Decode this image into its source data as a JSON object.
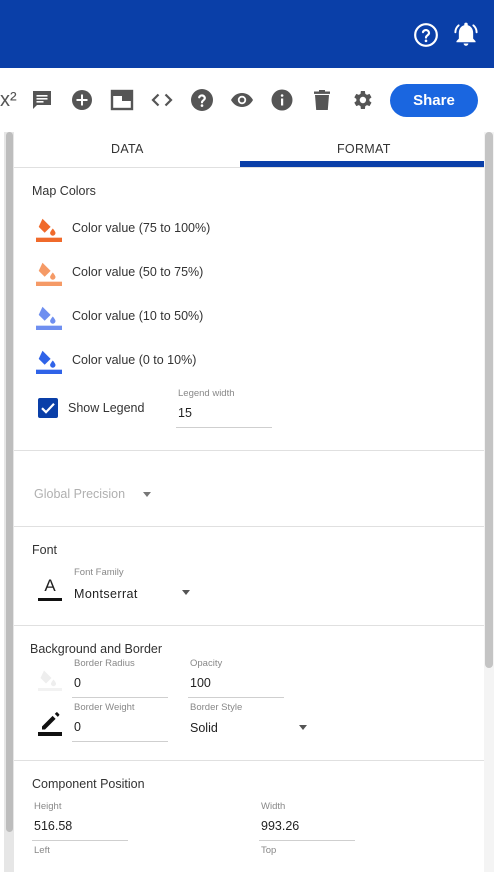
{
  "colors": {
    "topbar": "#0a3fa8",
    "share_button": "#1a66e0",
    "tab_active_underline": "#0a3fa8",
    "checkbox": "#0a3fa8",
    "map_color_75_100": "#f06a2b",
    "map_color_50_75": "#f59a66",
    "map_color_10_50": "#6f8ff0",
    "map_color_0_10": "#2f63e8"
  },
  "topbar": {
    "icons": [
      "help-circle-icon",
      "bell-alert-icon"
    ]
  },
  "toolbar": {
    "icons": [
      "superscript-icon",
      "comment-icon",
      "add-circle-icon",
      "window-icon",
      "code-icon",
      "help-icon",
      "eye-icon",
      "info-icon",
      "delete-icon",
      "gear-icon"
    ],
    "superscript_glyph": "x²",
    "share_label": "Share"
  },
  "tabs": [
    {
      "label": "DATA",
      "active": false
    },
    {
      "label": "FORMAT",
      "active": true
    }
  ],
  "map_colors": {
    "title": "Map Colors",
    "items": [
      {
        "label": "Color value (75 to 100%)"
      },
      {
        "label": "Color value (50 to 75%)"
      },
      {
        "label": "Color value (10 to 50%)"
      },
      {
        "label": "Color value (0 to 10%)"
      }
    ],
    "show_legend": {
      "label": "Show Legend",
      "checked": true
    },
    "legend_width": {
      "label": "Legend width",
      "value": "15"
    }
  },
  "global_precision": {
    "label": "Global Precision"
  },
  "font": {
    "title": "Font",
    "font_family": {
      "label": "Font Family",
      "value": "Montserrat"
    },
    "font_icon_glyph": "A"
  },
  "background_border": {
    "title": "Background and Border",
    "border_radius": {
      "label": "Border Radius",
      "value": "0"
    },
    "opacity": {
      "label": "Opacity",
      "value": "100"
    },
    "border_weight": {
      "label": "Border Weight",
      "value": "0"
    },
    "border_style": {
      "label": "Border Style",
      "value": "Solid"
    }
  },
  "component_position": {
    "title": "Component Position",
    "height": {
      "label": "Height",
      "value": "516.58"
    },
    "width": {
      "label": "Width",
      "value": "993.26"
    },
    "left": {
      "label": "Left"
    },
    "top": {
      "label": "Top"
    }
  }
}
